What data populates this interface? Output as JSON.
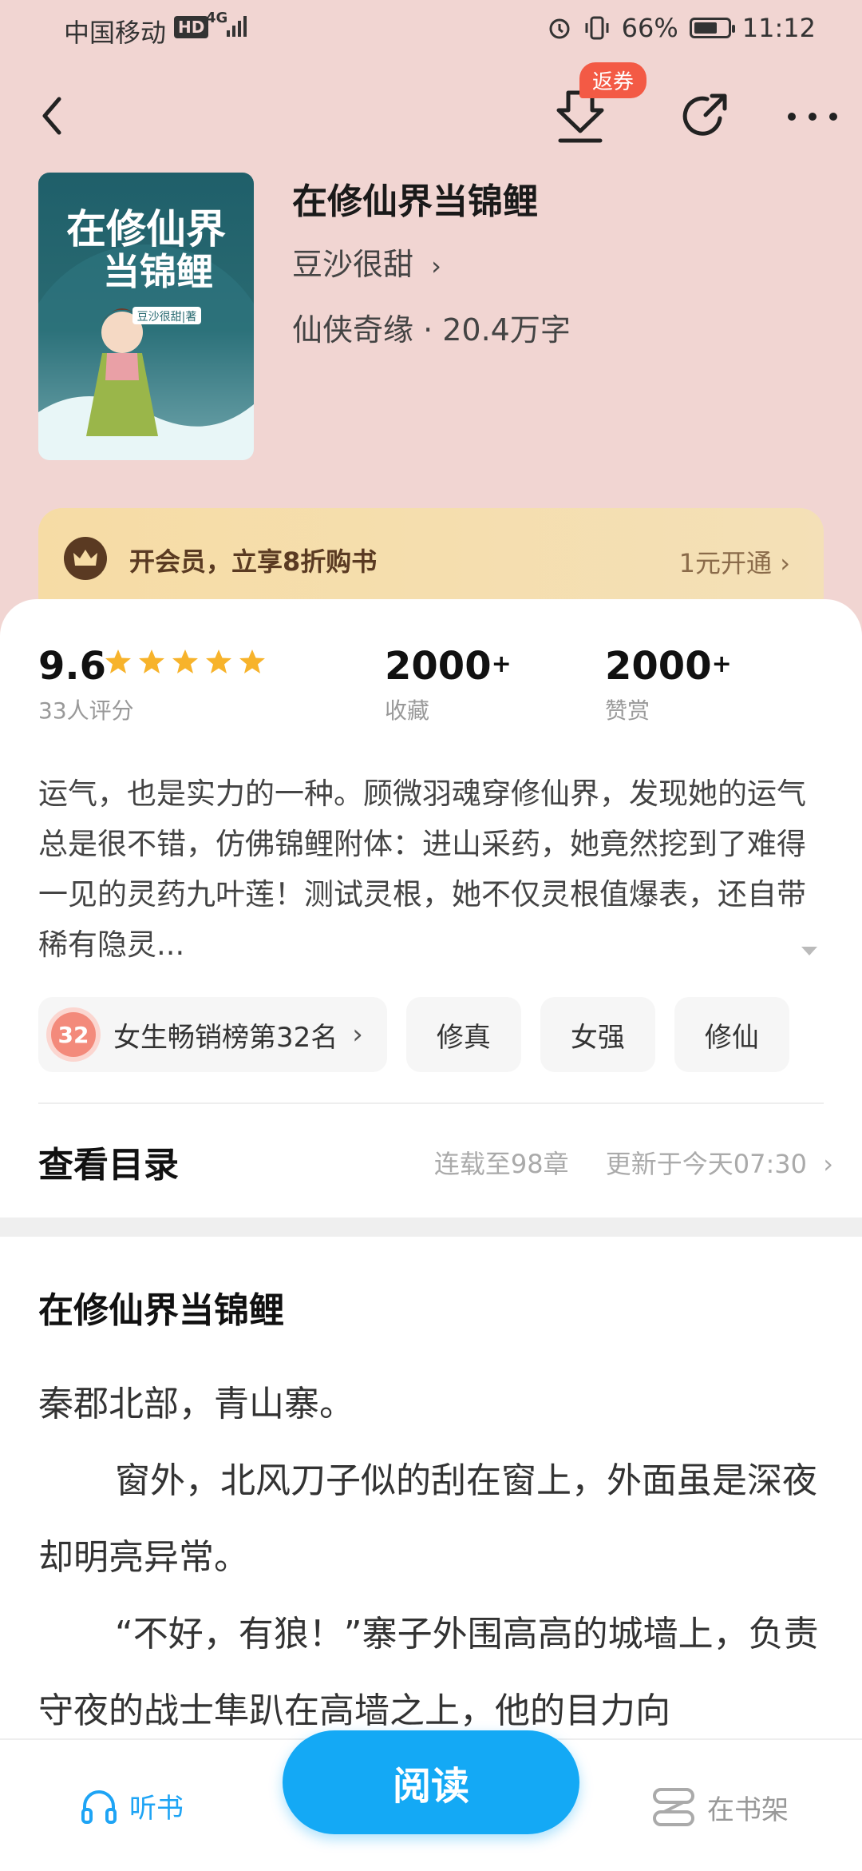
{
  "status_bar": {
    "carrier": "中国移动",
    "hd": "HD",
    "network": "4G",
    "battery": "66%",
    "battery_level": 0.66,
    "time": "11:12"
  },
  "nav": {
    "coupon_badge": "返券"
  },
  "book": {
    "title": "在修仙界当锦鲤",
    "author": "豆沙很甜",
    "meta": "仙侠奇缘 · 20.4万字",
    "cover_title_line1": "在修仙界",
    "cover_title_line2": "当锦鲤",
    "cover_author": "豆沙很甜|著"
  },
  "vip": {
    "text": "开会员，立享8折购书",
    "cta": "1元开通"
  },
  "stats": {
    "rating": "9.6",
    "rating_count": "33人评分",
    "stars": 5,
    "favorites": "2000",
    "favorites_suffix": "+",
    "favorites_label": "收藏",
    "rewards": "2000",
    "rewards_suffix": "+",
    "rewards_label": "赞赏"
  },
  "description": "运气，也是实力的一种。顾微羽魂穿修仙界，发现她的运气总是很不错，仿佛锦鲤附体：进山采药，她竟然挖到了难得一见的灵药九叶莲！测试灵根，她不仅灵根值爆表，还自带稀有隐灵...",
  "tags": {
    "rank_number": "32",
    "rank_label": "女生畅销榜第32名",
    "items": [
      "修真",
      "女强",
      "修仙"
    ]
  },
  "toc": {
    "title": "查看目录",
    "status": "连载至98章",
    "updated": "更新于今天07:30"
  },
  "chapter": {
    "title": "在修仙界当锦鲤",
    "p1": "秦郡北部，青山寨。",
    "p2": "窗外，北风刀子似的刮在窗上，外面虽是深夜却明亮异常。",
    "p3": "“不好，有狼！”寨子外围高高的城墙上，负责守夜的战士隼趴在高墙之上，他的目力向"
  },
  "bottom_bar": {
    "listen": "听书",
    "read": "阅读",
    "shelf": "在书架"
  },
  "colors": {
    "header_bg": "#f1d5d2",
    "accent": "#14a9f5",
    "coupon": "#f35a45",
    "star": "#f7b32b"
  }
}
